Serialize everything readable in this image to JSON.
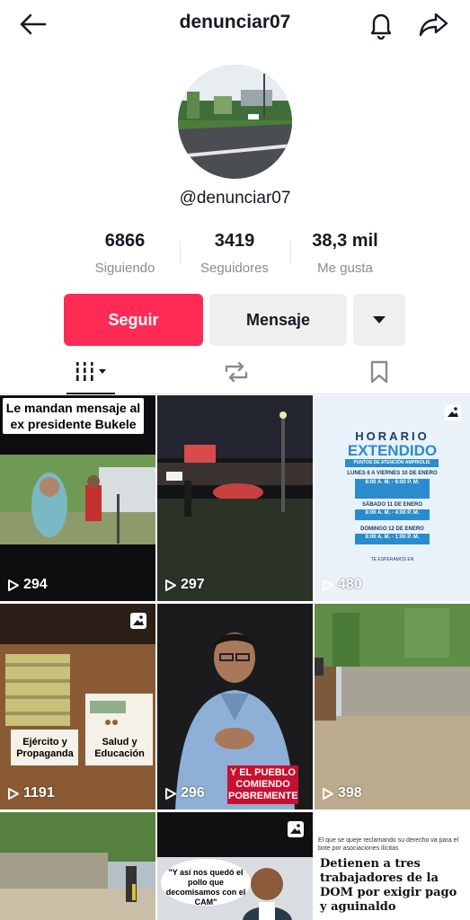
{
  "header": {
    "title": "denunciar07",
    "back_icon": "arrow-left-icon",
    "bell_icon": "bell-icon",
    "share_icon": "share-arrow-icon"
  },
  "profile": {
    "handle": "@denunciar07",
    "stats": [
      {
        "value": "6866",
        "label": "Siguiendo"
      },
      {
        "value": "3419",
        "label": "Seguidores"
      },
      {
        "value": "38,3 mil",
        "label": "Me gusta"
      }
    ]
  },
  "actions": {
    "follow_label": "Seguir",
    "message_label": "Mensaje",
    "more_icon": "caret-down-icon"
  },
  "colors": {
    "accent": "#fe2c55",
    "secondary_button": "#efeff0",
    "muted_text": "#8a8b91"
  },
  "tabs": [
    {
      "name": "videos",
      "icon": "grid-bars-icon"
    },
    {
      "name": "reposts",
      "icon": "repost-icon"
    },
    {
      "name": "saved",
      "icon": "bookmark-icon"
    }
  ],
  "videos": [
    {
      "views": "294",
      "caption": "Le mandan mensaje al ex presidente Bukele"
    },
    {
      "views": "297"
    },
    {
      "views": "480",
      "photo": true,
      "poster": {
        "title": "HORARIO",
        "subtitle": "EXTENDIDO",
        "band": "PUNTOS DE ATENCIÓN AMPRIOLIS",
        "days": [
          {
            "day": "LUNES 6 A VIERNES 10 DE ENERO",
            "hours": "8:00 A. M. - 6:00 P. M."
          },
          {
            "day": "SÁBADO 11 DE ENERO",
            "hours": "8:00 A. M. - 4:00 P. M."
          },
          {
            "day": "DOMINGO 12 DE ENERO",
            "hours": "8:00 A. M. - 1:00 P. M."
          }
        ],
        "footer": "TE ESPERAMOS EN"
      }
    },
    {
      "views": "1191",
      "photo": true,
      "labels": [
        "Ejército y Propaganda",
        "Salud y Educación"
      ]
    },
    {
      "views": "296",
      "tag": "Y EL PUEBLO COMIENDO POBREMENTE"
    },
    {
      "views": "398"
    },
    {
      "views": ""
    },
    {
      "views": "",
      "photo": true,
      "bubble": "\"Y así nos quedó el pollo que decomisamos con el CAM\""
    },
    {
      "views": "",
      "news_top": "El que se queje reclamando su derecho va para el bote por asociaciones ilícitas",
      "news_headline": "Detienen a tres trabajadores de la DOM por exigir pago y aguinaldo"
    }
  ]
}
